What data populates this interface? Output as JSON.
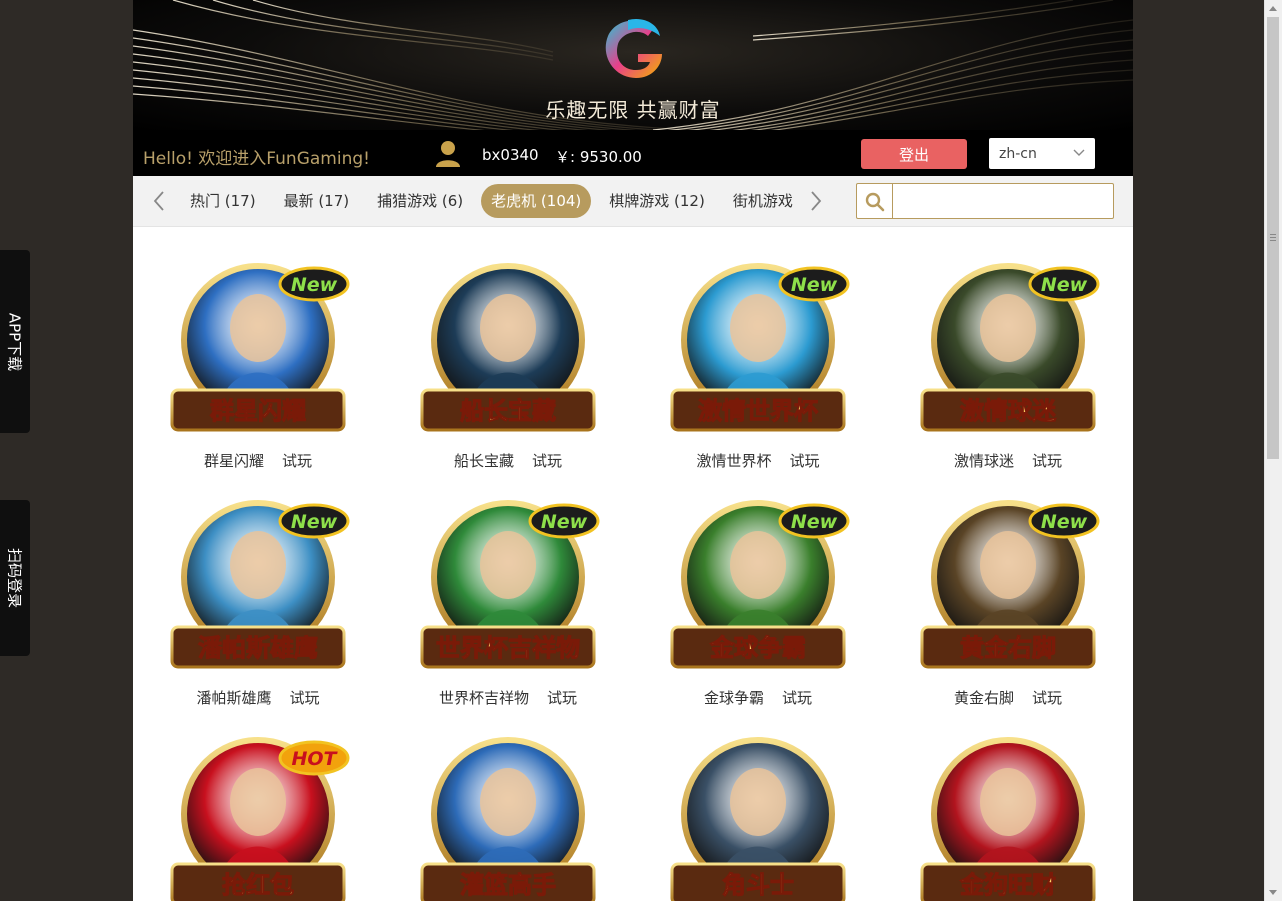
{
  "banner": {
    "slogan": "乐趣无限 共赢财富"
  },
  "userbar": {
    "hello": "Hello! 欢迎进入FunGaming!",
    "username": "bx0340",
    "balance": "￥: 9530.00",
    "logout_label": "登出",
    "language": "zh-cn"
  },
  "categories": {
    "tabs": [
      {
        "label": "热门 (17)"
      },
      {
        "label": "最新 (17)"
      },
      {
        "label": "捕猎游戏 (6)"
      },
      {
        "label": "老虎机 (104)"
      },
      {
        "label": "棋牌游戏 (12)"
      },
      {
        "label": "街机游戏"
      }
    ],
    "active_tab": "老虎机 (104)",
    "search_placeholder": ""
  },
  "games": [
    {
      "name": "群星闪耀",
      "try": "试玩",
      "icon_title": "群星闪耀",
      "badge": "New",
      "theme": "#2e6fc2"
    },
    {
      "name": "船长宝藏",
      "try": "试玩",
      "icon_title": "船长宝藏",
      "badge": "",
      "theme": "#1d3c57"
    },
    {
      "name": "激情世界杯",
      "try": "试玩",
      "icon_title": "激情世界杯",
      "badge": "New",
      "theme": "#2c9bd1"
    },
    {
      "name": "激情球迷",
      "try": "试玩",
      "icon_title": "激情球迷",
      "badge": "New",
      "theme": "#3a4a2a"
    },
    {
      "name": "潘帕斯雄鹰",
      "try": "试玩",
      "icon_title": "潘帕斯雄鹰",
      "badge": "New",
      "theme": "#3d8fc4"
    },
    {
      "name": "世界杯吉祥物",
      "try": "试玩",
      "icon_title": "世界杯吉祥物",
      "badge": "New",
      "theme": "#2f8a3a"
    },
    {
      "name": "金球争霸",
      "try": "试玩",
      "icon_title": "金球争霸",
      "badge": "New",
      "theme": "#3a7f2c"
    },
    {
      "name": "黄金右脚",
      "try": "试玩",
      "icon_title": "黄金右脚",
      "badge": "New",
      "theme": "#5a4426"
    },
    {
      "name": "",
      "try": "",
      "icon_title": "抢红包",
      "badge": "HOT",
      "theme": "#c8101e"
    },
    {
      "name": "",
      "try": "",
      "icon_title": "灌篮高手",
      "badge": "",
      "theme": "#2d6bb8"
    },
    {
      "name": "",
      "try": "",
      "icon_title": "角斗士",
      "badge": "",
      "theme": "#3a5066"
    },
    {
      "name": "",
      "try": "",
      "icon_title": "金狗旺财",
      "badge": "",
      "theme": "#b2141e"
    }
  ],
  "side": {
    "app_download": "APP下载",
    "scan_login": "扫码登录"
  },
  "icons": [
    "logo-icon",
    "avatar-icon",
    "chevron-down-icon",
    "chevron-left-icon",
    "chevron-right-icon",
    "search-icon"
  ],
  "colors": {
    "gold": "#b79b5e",
    "logout": "#e96262",
    "nav_bg": "#f2f2f2"
  }
}
